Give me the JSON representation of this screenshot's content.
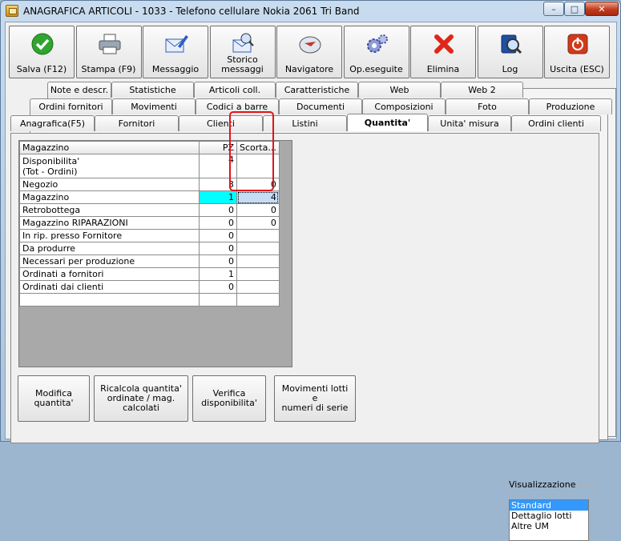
{
  "window": {
    "title": "ANAGRAFICA ARTICOLI - 1033 - Telefono cellulare Nokia 2061 Tri Band",
    "controls": {
      "minimize": "–",
      "maximize": "□",
      "close": "✕"
    }
  },
  "toolbar": {
    "buttons": [
      {
        "label": "Salva (F12)",
        "icon": "check-icon",
        "color": "#2fa52f"
      },
      {
        "label": "Stampa (F9)",
        "icon": "printer-icon",
        "color": "#6b7a8c"
      },
      {
        "label": "Messaggio",
        "icon": "envelope-pen-icon",
        "color": "#2f5fbf"
      },
      {
        "label": "Storico\nmessaggi",
        "icon": "envelope-search-icon",
        "color": "#2f5fbf"
      },
      {
        "label": "Navigatore",
        "icon": "compass-icon",
        "color": "#c0392b"
      },
      {
        "label": "Op.eseguite",
        "icon": "gears-icon",
        "color": "#5c6bc0"
      },
      {
        "label": "Elimina",
        "icon": "delete-x-icon",
        "color": "#e0261b"
      },
      {
        "label": "Log",
        "icon": "book-search-icon",
        "color": "#1f4fa0"
      },
      {
        "label": "Uscita (ESC)",
        "icon": "power-icon",
        "color": "#d03a1a"
      }
    ]
  },
  "tabs": {
    "row1": [
      "Note e descr.",
      "Statistiche",
      "Articoli coll.",
      "Caratteristiche",
      "Web",
      "Web 2"
    ],
    "row2": [
      "Ordini fornitori",
      "Movimenti",
      "Codici a barre",
      "Documenti",
      "Composizioni",
      "Foto",
      "Produzione"
    ],
    "row3": [
      "Anagrafica(F5)",
      "Fornitori",
      "Clienti",
      "Listini",
      "Quantita'",
      "Unita' misura",
      "Ordini clienti"
    ],
    "active": "Quantita'"
  },
  "grid": {
    "headers": [
      "Magazzino",
      "PZ",
      "Scorta..."
    ],
    "rows": [
      {
        "name": "Disponibilita'\n (Tot - Ordini)",
        "pz": "4",
        "scorta": ""
      },
      {
        "name": "Negozio",
        "pz": "3",
        "scorta": "0"
      },
      {
        "name": "Magazzino",
        "pz": "1",
        "scorta": "4"
      },
      {
        "name": "Retrobottega",
        "pz": "0",
        "scorta": "0"
      },
      {
        "name": "Magazzino RIPARAZIONI",
        "pz": "0",
        "scorta": "0"
      },
      {
        "name": "In rip. presso Fornitore",
        "pz": "0",
        "scorta": ""
      },
      {
        "name": "Da produrre",
        "pz": "0",
        "scorta": ""
      },
      {
        "name": "Necessari per produzione",
        "pz": "0",
        "scorta": ""
      },
      {
        "name": "Ordinati a fornitori",
        "pz": "1",
        "scorta": ""
      },
      {
        "name": "Ordinati dai clienti",
        "pz": "0",
        "scorta": ""
      },
      {
        "name": "",
        "pz": "",
        "scorta": ""
      }
    ],
    "selected_row": "Magazzino",
    "highlight_color": "#00ffff",
    "annotation_color": "#e0141b"
  },
  "actions": [
    "Modifica\nquantita'",
    "Ricalcola quantita'\nordinate / mag.\ncalcolati",
    "Verifica\ndisponibilita'",
    "Movimenti lotti e\nnumeri di serie"
  ],
  "visualizzazione": {
    "legend": "Visualizzazione",
    "options": [
      "Standard",
      "Dettaglio lotti",
      "Altre UM"
    ],
    "selected": "Standard"
  }
}
